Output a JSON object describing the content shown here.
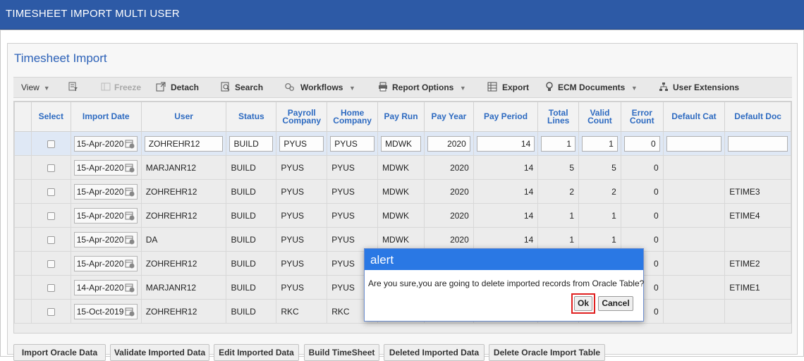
{
  "window": {
    "title": "TIMESHEET IMPORT MULTI USER"
  },
  "panel": {
    "title": "Timesheet Import"
  },
  "toolbar": {
    "view": "View",
    "freeze": "Freeze",
    "detach": "Detach",
    "search": "Search",
    "workflows": "Workflows",
    "report_options": "Report Options",
    "export": "Export",
    "ecm_documents": "ECM Documents",
    "user_extensions": "User Extensions"
  },
  "table": {
    "headers": {
      "select": "Select",
      "import_date": "Import Date",
      "user": "User",
      "status": "Status",
      "payroll_company": "Payroll Company",
      "home_company": "Home Company",
      "pay_run": "Pay Run",
      "pay_year": "Pay Year",
      "pay_period": "Pay Period",
      "total_lines": "Total Lines",
      "valid_count": "Valid Count",
      "error_count": "Error Count",
      "default_cat": "Default Cat",
      "default_doc": "Default Doc"
    },
    "rows": [
      {
        "import_date": "15-Apr-2020",
        "user": "ZOHREHR12",
        "status": "BUILD",
        "payroll_company": "PYUS",
        "home_company": "PYUS",
        "pay_run": "MDWK",
        "pay_year": "2020",
        "pay_period": "14",
        "total_lines": "1",
        "valid_count": "1",
        "error_count": "0",
        "default_cat": "",
        "default_doc": ""
      },
      {
        "import_date": "15-Apr-2020",
        "user": "MARJANR12",
        "status": "BUILD",
        "payroll_company": "PYUS",
        "home_company": "PYUS",
        "pay_run": "MDWK",
        "pay_year": "2020",
        "pay_period": "14",
        "total_lines": "5",
        "valid_count": "5",
        "error_count": "0",
        "default_cat": "",
        "default_doc": ""
      },
      {
        "import_date": "15-Apr-2020",
        "user": "ZOHREHR12",
        "status": "BUILD",
        "payroll_company": "PYUS",
        "home_company": "PYUS",
        "pay_run": "MDWK",
        "pay_year": "2020",
        "pay_period": "14",
        "total_lines": "2",
        "valid_count": "2",
        "error_count": "0",
        "default_cat": "",
        "default_doc": "ETIME3"
      },
      {
        "import_date": "15-Apr-2020",
        "user": "ZOHREHR12",
        "status": "BUILD",
        "payroll_company": "PYUS",
        "home_company": "PYUS",
        "pay_run": "MDWK",
        "pay_year": "2020",
        "pay_period": "14",
        "total_lines": "1",
        "valid_count": "1",
        "error_count": "0",
        "default_cat": "",
        "default_doc": "ETIME4"
      },
      {
        "import_date": "15-Apr-2020",
        "user": "DA",
        "status": "BUILD",
        "payroll_company": "PYUS",
        "home_company": "PYUS",
        "pay_run": "MDWK",
        "pay_year": "2020",
        "pay_period": "14",
        "total_lines": "1",
        "valid_count": "1",
        "error_count": "0",
        "default_cat": "",
        "default_doc": ""
      },
      {
        "import_date": "15-Apr-2020",
        "user": "ZOHREHR12",
        "status": "BUILD",
        "payroll_company": "PYUS",
        "home_company": "PYUS",
        "pay_run": "",
        "pay_year": "",
        "pay_period": "",
        "total_lines": "",
        "valid_count": "",
        "error_count": "0",
        "default_cat": "",
        "default_doc": "ETIME2"
      },
      {
        "import_date": "14-Apr-2020",
        "user": "MARJANR12",
        "status": "BUILD",
        "payroll_company": "PYUS",
        "home_company": "PYUS",
        "pay_run": "",
        "pay_year": "",
        "pay_period": "",
        "total_lines": "",
        "valid_count": "",
        "error_count": "0",
        "default_cat": "",
        "default_doc": "ETIME1"
      },
      {
        "import_date": "15-Oct-2019",
        "user": "ZOHREHR12",
        "status": "BUILD",
        "payroll_company": "RKC",
        "home_company": "RKC",
        "pay_run": "",
        "pay_year": "",
        "pay_period": "",
        "total_lines": "",
        "valid_count": "",
        "error_count": "0",
        "default_cat": "",
        "default_doc": ""
      }
    ]
  },
  "buttons": {
    "import_oracle_data": "Import Oracle Data",
    "validate_imported_data": "Validate Imported Data",
    "edit_imported_data": "Edit Imported Data",
    "build_timesheet": "Build TimeSheet",
    "deleted_imported_data": "Deleted Imported Data",
    "delete_oracle_import_table": "Delete Oracle Import Table"
  },
  "dialog": {
    "title": "alert",
    "message": "Are you sure,you are going to delete imported records from Oracle Table?",
    "ok": "Ok",
    "cancel": "Cancel"
  },
  "colors": {
    "header_bar": "#2d5aa6",
    "accent_blue": "#2e6bc1",
    "dialog_header": "#2a78e4",
    "highlight_red": "#e02020",
    "selected_row": "#dfe8f5"
  }
}
